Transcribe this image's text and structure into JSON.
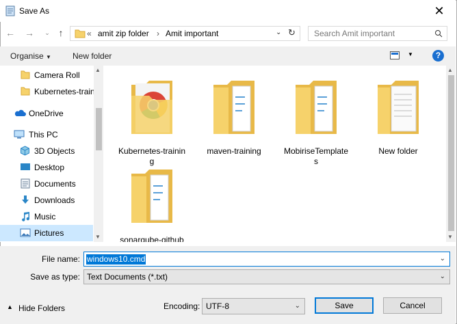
{
  "window": {
    "title": "Save As",
    "close_glyph": "✕"
  },
  "nav": {
    "breadcrumb": [
      "amit zip folder",
      "Amit important"
    ],
    "overflow": "«",
    "separator": "›",
    "search_placeholder": "Search Amit important"
  },
  "toolbar": {
    "organise": "Organise",
    "new_folder": "New folder"
  },
  "sidebar": {
    "items": [
      {
        "label": "Camera Roll",
        "icon": "folder-icon",
        "type": "child"
      },
      {
        "label": "Kubernetes-train",
        "icon": "folder-icon",
        "type": "child"
      },
      {
        "label": "OneDrive",
        "icon": "cloud-icon",
        "type": "top"
      },
      {
        "label": "This PC",
        "icon": "computer-icon",
        "type": "top"
      },
      {
        "label": "3D Objects",
        "icon": "cube-icon",
        "type": "child"
      },
      {
        "label": "Desktop",
        "icon": "desktop-icon",
        "type": "child"
      },
      {
        "label": "Documents",
        "icon": "documents-icon",
        "type": "child"
      },
      {
        "label": "Downloads",
        "icon": "download-icon",
        "type": "child"
      },
      {
        "label": "Music",
        "icon": "music-icon",
        "type": "child"
      },
      {
        "label": "Pictures",
        "icon": "pictures-icon",
        "type": "child",
        "selected": true
      }
    ]
  },
  "files": [
    {
      "name": "Kubernetes-training",
      "icon": "chrome-folder-icon"
    },
    {
      "name": "maven-training",
      "icon": "folder-docs-icon"
    },
    {
      "name": "MobiriseTemplates",
      "icon": "folder-docs-icon"
    },
    {
      "name": "New folder",
      "icon": "folder-paper-icon"
    },
    {
      "name": "sonarqube-github",
      "icon": "folder-docs-icon"
    }
  ],
  "form": {
    "file_name_label": "File name:",
    "file_name_value": "windows10.cmd",
    "save_type_label": "Save as type:",
    "save_type_value": "Text Documents (*.txt)",
    "hide_folders": "Hide Folders",
    "encoding_label": "Encoding:",
    "encoding_value": "UTF-8",
    "save": "Save",
    "cancel": "Cancel"
  },
  "colors": {
    "accent": "#0078d7",
    "selection": "#cce8ff",
    "folder": "#f6d26b",
    "help": "#1a6fd0"
  }
}
